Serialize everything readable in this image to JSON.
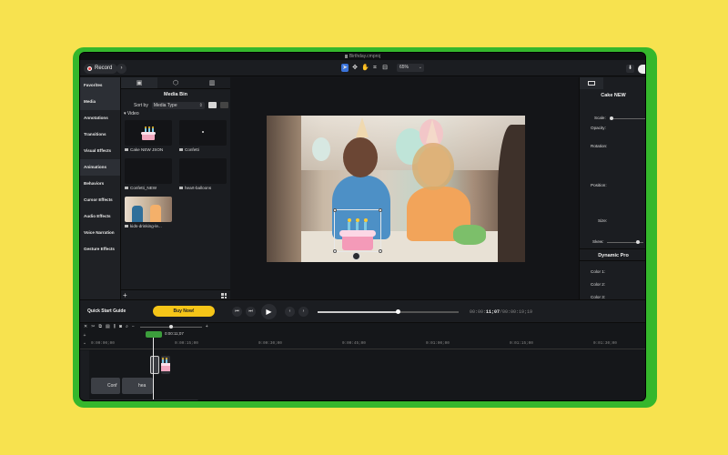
{
  "window": {
    "title": "Birthday.cmproj"
  },
  "toolbar": {
    "record_label": "Record",
    "zoom_value": "65%"
  },
  "categories": [
    "Favorites",
    "Media",
    "Annotations",
    "Transitions",
    "Visual Effects",
    "Animations",
    "Behaviors",
    "Cursor Effects",
    "Audio Effects",
    "Voice Narration",
    "Gesture Effects"
  ],
  "media_bin": {
    "title": "Media Bin",
    "sort_label": "Sort by",
    "sort_value": "Media Type",
    "section_label": "Video",
    "items": [
      {
        "name": "Cake NEW JSON"
      },
      {
        "name": "Confetti"
      },
      {
        "name": "Confetti_NEW"
      },
      {
        "name": "heart-balloons"
      },
      {
        "name": "kids-drinking-le..."
      }
    ]
  },
  "properties": {
    "title": "Cake NEW",
    "scale_label": "Scale:",
    "opacity_label": "Opacity:",
    "rotation_label": "Rotation:",
    "position_label": "Position:",
    "size_label": "Size:",
    "skew_label": "Skew:",
    "dynamic_title": "Dynamic Pro",
    "color1_label": "Color 1:",
    "color2_label": "Color 2:",
    "color3_label": "Color 3:"
  },
  "playback": {
    "quick_start_label": "Quick Start Guide",
    "buy_label": "Buy Now!",
    "time_prefix": "00:00:",
    "time_current": "11;07",
    "time_total": "/00:00:19;19"
  },
  "timeline": {
    "playhead_time": "0:00:11;07",
    "ticks": [
      "0:00:00;00",
      "0:00:15;00",
      "0:00:30;00",
      "0:00:45;00",
      "0:01:00;00",
      "0:01:15;00",
      "0:01:30;00"
    ],
    "clips": [
      {
        "label": "Conf"
      },
      {
        "label": "hea"
      }
    ]
  },
  "colors": {
    "background": "#f7e24f",
    "frame": "#35b72c",
    "buy_button": "#f5c518",
    "record_dot": "#e84545",
    "accent": "#3a73d9"
  }
}
